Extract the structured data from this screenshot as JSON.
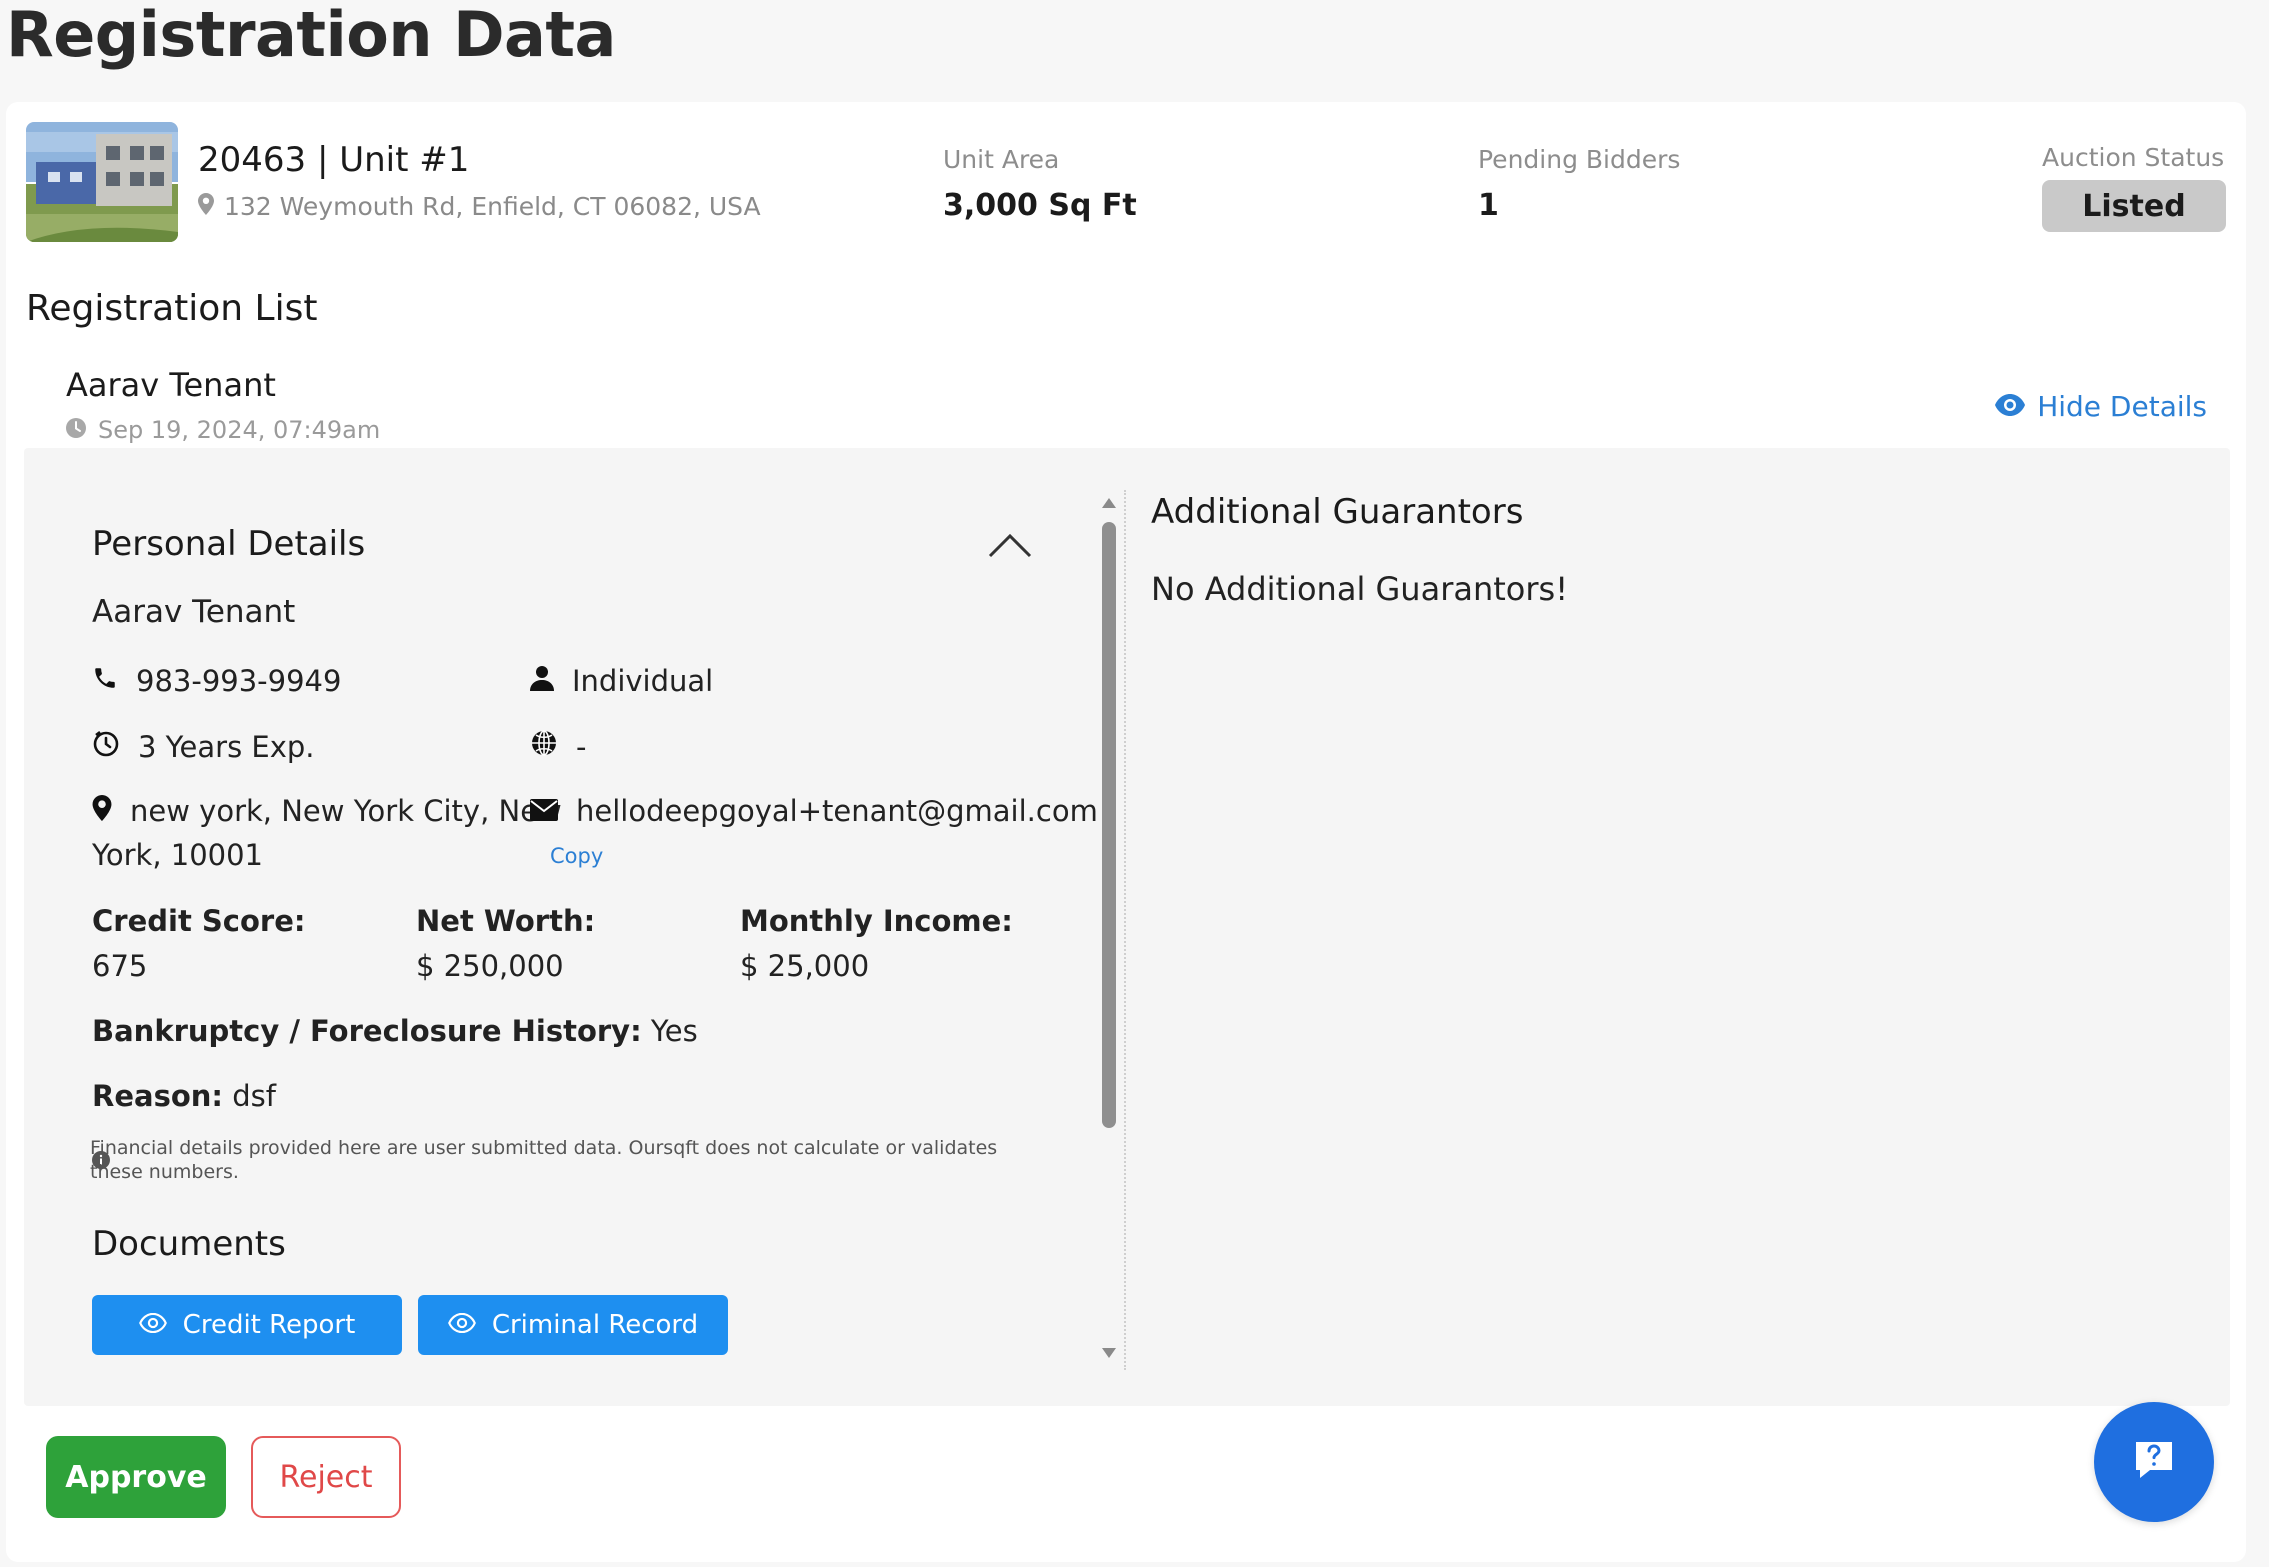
{
  "page": {
    "title": "Registration Data"
  },
  "property": {
    "title": "20463 | Unit #1",
    "address": "132 Weymouth Rd, Enfield, CT 06082, USA",
    "unit_area_label": "Unit Area",
    "unit_area_value": "3,000 Sq Ft",
    "pending_bidders_label": "Pending Bidders",
    "pending_bidders_value": "1",
    "auction_status_label": "Auction Status",
    "auction_status_value": "Listed"
  },
  "registration_list": {
    "title": "Registration List",
    "item": {
      "name": "Aarav Tenant",
      "timestamp": "Sep 19, 2024, 07:49am",
      "hide_details_label": "Hide Details"
    }
  },
  "personal_details": {
    "title": "Personal Details",
    "name": "Aarav Tenant",
    "phone": "983-993-9949",
    "type": "Individual",
    "experience": "3 Years Exp.",
    "website": "-",
    "location_line1": "new york, New York City, New",
    "location_line2": "York, 10001",
    "email": "hellodeepgoyal+tenant@gmail.com",
    "copy_label": "Copy",
    "credit_score_label": "Credit Score:",
    "credit_score_value": "675",
    "net_worth_label": "Net Worth:",
    "net_worth_value": "$ 250,000",
    "monthly_income_label": "Monthly Income:",
    "monthly_income_value": "$ 25,000",
    "bankruptcy_label": "Bankruptcy / Foreclosure History:",
    "bankruptcy_value": "Yes",
    "reason_label": "Reason:",
    "reason_value": "dsf",
    "note": "Financial details provided here are user submitted data. Oursqft does not calculate or validates these numbers."
  },
  "documents": {
    "title": "Documents",
    "buttons": [
      {
        "label": "Credit Report"
      },
      {
        "label": "Criminal Record"
      }
    ]
  },
  "guarantors": {
    "title": "Additional Guarantors",
    "empty_text": "No Additional Guarantors!"
  },
  "actions": {
    "approve_label": "Approve",
    "reject_label": "Reject"
  },
  "icons": {
    "location": "map-pin-icon",
    "clock": "clock-icon",
    "eye": "eye-icon",
    "phone": "phone-icon",
    "user": "user-icon",
    "timer": "timer-icon",
    "globe": "globe-icon",
    "email": "envelope-icon",
    "info": "info-icon",
    "help": "help-chat-icon",
    "collapse": "chevron-up-icon"
  },
  "colors": {
    "link": "#2b7fd4",
    "primary_button": "#1e8ff0",
    "approve": "#2ea23a",
    "reject": "#e04848",
    "status_badge": "#c9c9c9",
    "help_fab": "#1f6fe0"
  }
}
